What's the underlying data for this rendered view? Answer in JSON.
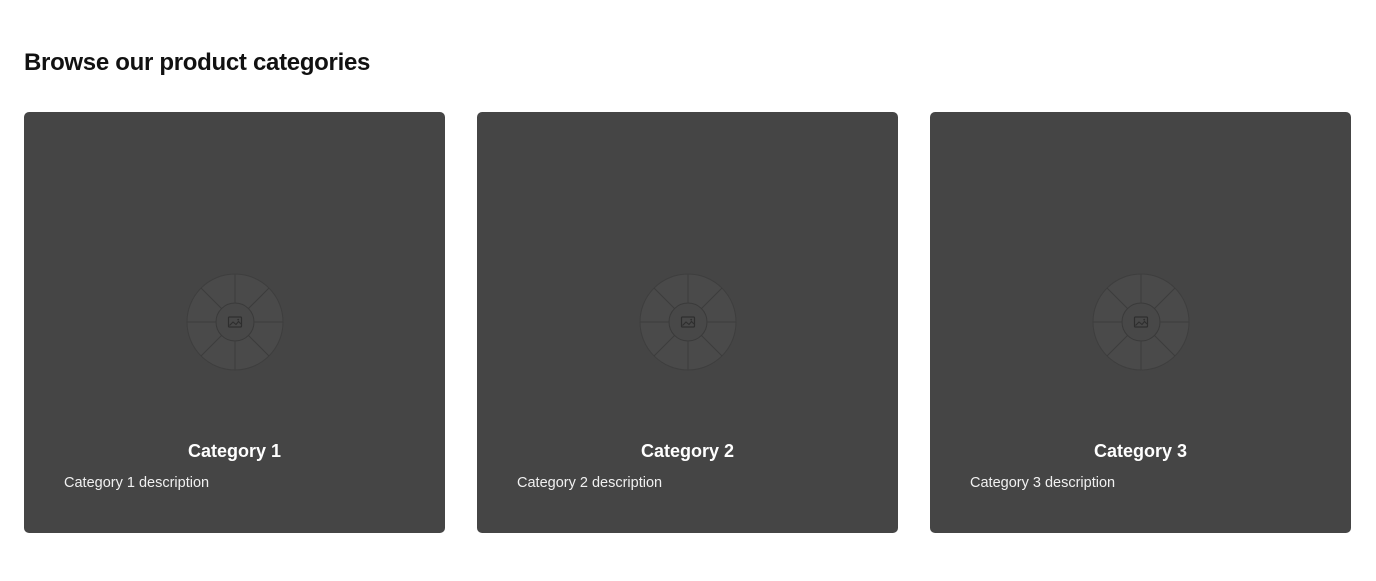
{
  "section": {
    "title": "Browse our product categories"
  },
  "categories": [
    {
      "title": "Category 1",
      "description": "Category 1 description",
      "icon": "image-placeholder-icon"
    },
    {
      "title": "Category 2",
      "description": "Category 2 description",
      "icon": "image-placeholder-icon"
    },
    {
      "title": "Category 3",
      "description": "Category 3 description",
      "icon": "image-placeholder-icon"
    }
  ],
  "colors": {
    "card_background": "#454545",
    "heading": "#111111",
    "card_text": "#ffffff"
  }
}
